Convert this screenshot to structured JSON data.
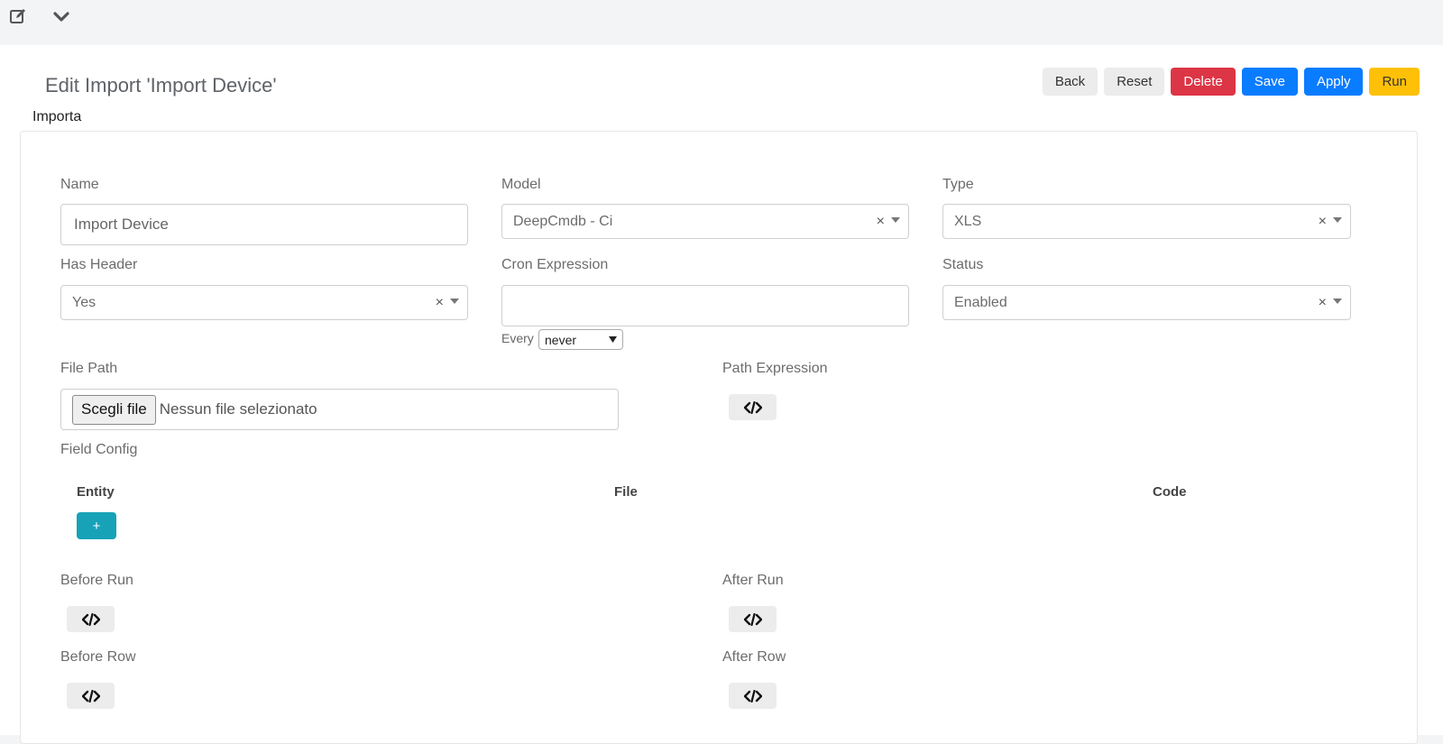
{
  "page": {
    "title": "Edit Import 'Import Device'",
    "section_label": "Importa"
  },
  "toolbar": {
    "back": "Back",
    "reset": "Reset",
    "delete": "Delete",
    "save": "Save",
    "apply": "Apply",
    "run": "Run"
  },
  "form": {
    "name": {
      "label": "Name",
      "value": "Import Device"
    },
    "model": {
      "label": "Model",
      "value": "DeepCmdb - Ci"
    },
    "type": {
      "label": "Type",
      "value": "XLS"
    },
    "has_header": {
      "label": "Has Header",
      "value": "Yes"
    },
    "cron": {
      "label": "Cron Expression",
      "value": "",
      "every_label": "Every",
      "every_value": "never"
    },
    "status": {
      "label": "Status",
      "value": "Enabled"
    },
    "file_path": {
      "label": "File Path",
      "button": "Scegli file",
      "no_file": "Nessun file selezionato"
    },
    "path_expression": {
      "label": "Path Expression"
    },
    "field_config": {
      "label": "Field Config",
      "columns": [
        "Entity",
        "File",
        "Code"
      ],
      "add_label": "+"
    },
    "before_run": {
      "label": "Before Run"
    },
    "after_run": {
      "label": "After Run"
    },
    "before_row": {
      "label": "Before Row"
    },
    "after_row": {
      "label": "After Row"
    }
  },
  "icons": {
    "edit": "edit-icon",
    "chevron": "chevron-down-icon",
    "code": "code-icon",
    "clear": "×"
  },
  "colors": {
    "danger": "#dc3545",
    "primary": "#0a7cff",
    "warning": "#ffc107",
    "info": "#17a2b8"
  }
}
